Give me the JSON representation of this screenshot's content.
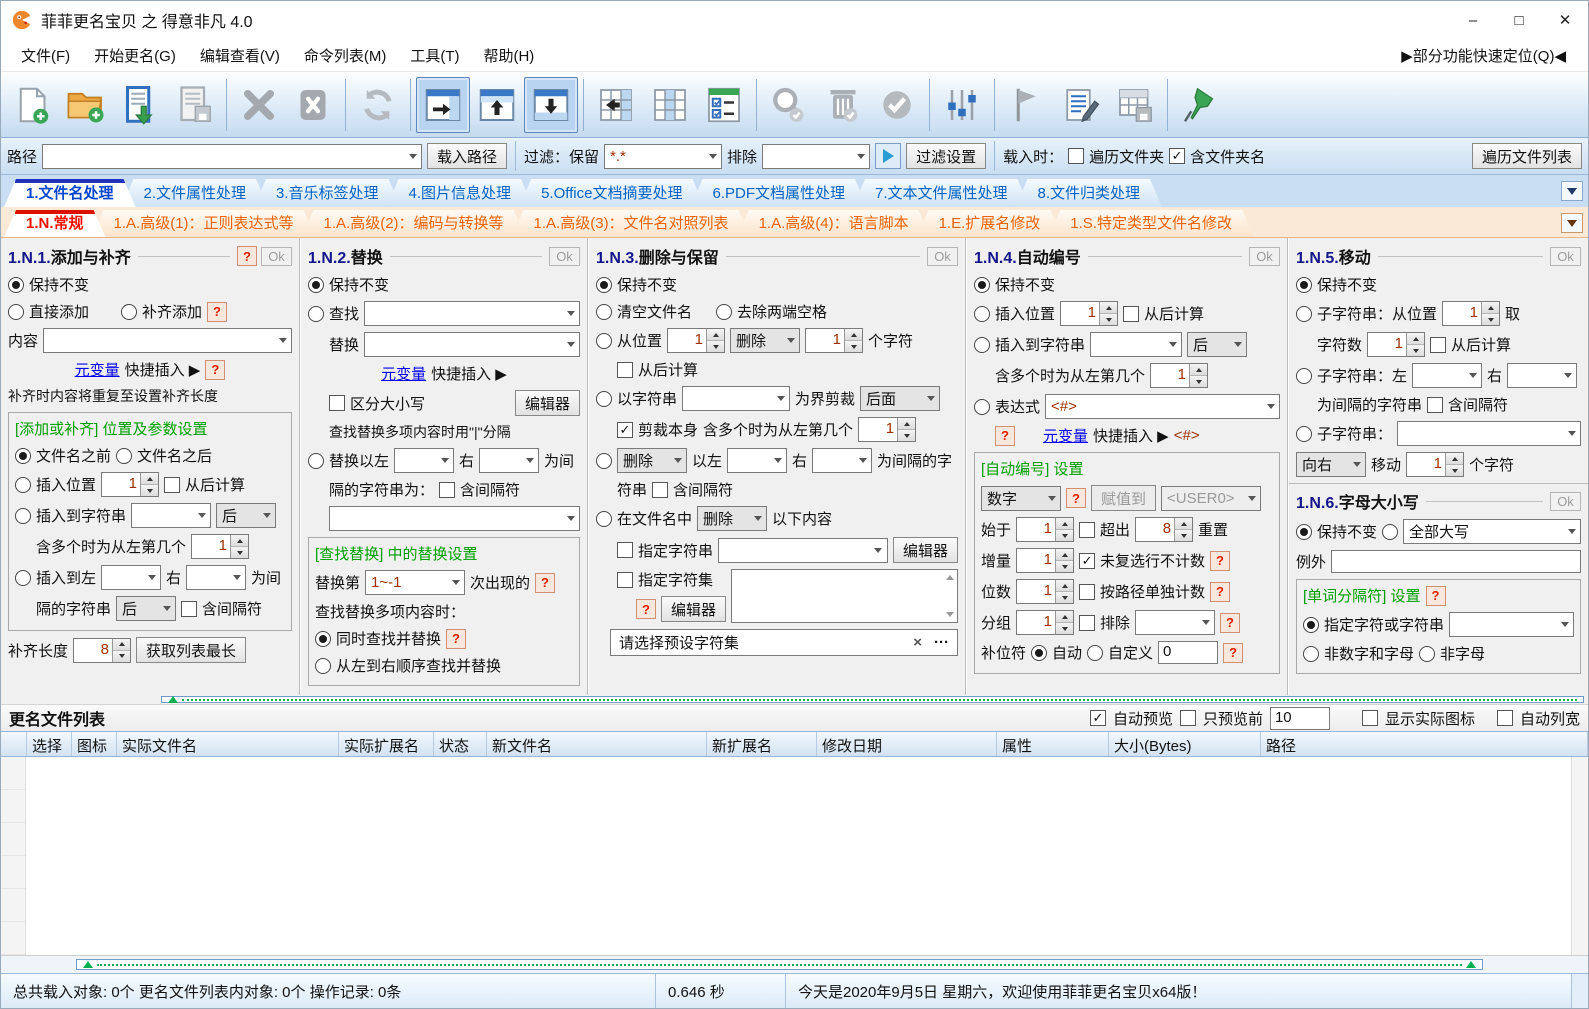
{
  "window": {
    "title": "菲菲更名宝贝 之 得意非凡 4.0",
    "minimize": "–",
    "maximize": "□",
    "close": "✕"
  },
  "menu": {
    "items": [
      "文件(F)",
      "开始更名(G)",
      "编辑查看(V)",
      "命令列表(M)",
      "工具(T)",
      "帮助(H)"
    ],
    "quick_locate": "▶部分功能快速定位(Q)◀"
  },
  "toolbar": {
    "icons": [
      "new-file-icon",
      "open-folder-add-icon",
      "load-list-icon",
      "save-list-icon",
      "delete-icon",
      "delete-box-icon",
      "refresh-icon",
      "panel-right-icon",
      "panel-top-icon",
      "panel-bottom-icon",
      "columns-move-icon",
      "columns-icon",
      "checklist-icon",
      "search-check-icon",
      "trash-check-icon",
      "apply-check-icon",
      "settings-sliders-icon",
      "flag-icon",
      "edit-log-icon",
      "export-table-icon",
      "pin-icon"
    ]
  },
  "pathbar": {
    "path_label": "路径",
    "load_path": "载入路径",
    "filter_label": "过滤：保留",
    "filter_value": "*.*",
    "exclude_label": "排除",
    "filter_settings": "过滤设置",
    "load_opts_label": "载入时：",
    "chk_traverse": "遍历文件夹",
    "chk_foldername": "含文件夹名",
    "traverse_button": "遍历文件列表"
  },
  "tabs_main": [
    "1.文件名处理",
    "2.文件属性处理",
    "3.音乐标签处理",
    "4.图片信息处理",
    "5.Office文档摘要处理",
    "6.PDF文档属性处理",
    "7.文本文件属性处理",
    "8.文件归类处理"
  ],
  "tabs_sub": [
    "1.N.常规",
    "1.A.高级(1)：正则表达式等",
    "1.A.高级(2)：编码与转换等",
    "1.A.高级(3)：文件名对照列表",
    "1.A.高级(4)：语言脚本",
    "1.E.扩展名修改",
    "1.S.特定类型文件名修改"
  ],
  "common": {
    "ok": "Ok",
    "help": "?",
    "keep": "保持不变",
    "editor": "编辑器",
    "meta_link": "元变量",
    "quick_insert": "快捷插入 ▶",
    "from_end": "从后计算",
    "incl_sep": "含间隔符",
    "right": "右",
    "after": "后",
    "multi_left": "含多个时为从左第几个"
  },
  "p1": {
    "num": "1.N.1.",
    "name": "添加与补齐",
    "radio_direct": "直接添加",
    "radio_pad": "补齐添加",
    "content_label": "内容",
    "note": "补齐时内容将重复至设置补齐长度",
    "group_title": "[添加或补齐] 位置及参数设置",
    "before": "文件名之前",
    "after_name": "文件名之后",
    "insert_pos": "插入位置",
    "pos_val": "1",
    "insert_to_str": "插入到字符串",
    "multi_val": "1",
    "insert_between": "插入到左",
    "between_suffix": "为间",
    "line_sep": "隔的字符串",
    "pad_len_label": "补齐长度",
    "pad_len": "8",
    "get_longest": "获取列表最长"
  },
  "p2": {
    "num": "1.N.2.",
    "name": "替换",
    "find": "查找",
    "replace": "替换",
    "case_sensitive": "区分大小写",
    "note": "查找替换多项内容时用\"|\"分隔",
    "rep_between": "替换以左",
    "between_suffix": "为间",
    "line2": "隔的字符串为：",
    "group_title": "[查找替换] 中的替换设置",
    "nth_label": "替换第",
    "nth_val": "1~-1",
    "nth_suffix": "次出现的",
    "multi_label": "查找替换多项内容时：",
    "simul": "同时查找并替换",
    "ordered": "从左到右顺序查找并替换"
  },
  "p3": {
    "num": "1.N.3.",
    "name": "删除与保留",
    "clear": "清空文件名",
    "trim": "去除两端空格",
    "from_pos": "从位置",
    "pos_val": "1",
    "del_combo": "删除",
    "count_val": "1",
    "chars_suffix": "个字符",
    "by_str": "以字符串",
    "cut_label": "为界剪裁",
    "cut_side": "后面",
    "cut_self": "剪裁本身",
    "multi_val": "1",
    "between_prefix": "以左",
    "between_suffix": "为间隔的字",
    "line_cont": "符串",
    "in_name": "在文件名中",
    "content_suffix": "以下内容",
    "spec_str": "指定字符串",
    "spec_set": "指定字符集",
    "preset_placeholder": "请选择预设字符集",
    "clear_x": "×",
    "more": "···"
  },
  "p4": {
    "num": "1.N.4.",
    "name": "自动编号",
    "insert_pos": "插入位置",
    "pos_val": "1",
    "insert_to_str": "插入到字符串",
    "multi_val": "1",
    "expr": "表达式",
    "expr_val": "<#>",
    "token": "<#>",
    "group_title": "[自动编号] 设置",
    "type_val": "数字",
    "assign": "赋值到",
    "assign_val": "<USER0>",
    "start": "始于",
    "start_val": "1",
    "over": "超出",
    "over_val": "8",
    "reset": "重置",
    "inc": "增量",
    "inc_val": "1",
    "uncheck": "未复选行不计数",
    "digits": "位数",
    "digits_val": "1",
    "per_path": "按路径单独计数",
    "group": "分组",
    "group_val": "1",
    "exclude": "排除",
    "pad_char": "补位符",
    "auto": "自动",
    "custom": "自定义",
    "custom_val": "0"
  },
  "p5": {
    "num": "1.N.5.",
    "name": "移动",
    "sub_pos": "子字符串：从位置",
    "pos_val": "1",
    "take": "取",
    "char_count": "字符数",
    "count_val": "1",
    "sub_lr": "子字符串：左",
    "sep_line": "为间隔的字符串",
    "sub_str": "子字符串：",
    "dir_val": "向右",
    "move": "移动",
    "move_val": "1",
    "chars": "个字符"
  },
  "p6": {
    "num": "1.N.6.",
    "name": "字母大小写",
    "case_val": "全部大写",
    "except": "例外",
    "group_title": "[单词分隔符] 设置",
    "spec": "指定字符或字符串",
    "non_alnum": "非数字和字母",
    "non_alpha": "非字母"
  },
  "filelist": {
    "section_title": "更名文件列表",
    "auto_preview": "自动预览",
    "preview_first": "只预览前",
    "preview_count": "10",
    "show_icons": "显示实际图标",
    "auto_width": "自动列宽",
    "columns": [
      "选择",
      "图标",
      "实际文件名",
      "实际扩展名",
      "状态",
      "新文件名",
      "新扩展名",
      "修改日期",
      "属性",
      "大小(Bytes)",
      "路径"
    ]
  },
  "statusbar": {
    "counts": "总共载入对象: 0个  更名文件列表内对象: 0个  操作记录: 0条",
    "time": "0.646 秒",
    "message": "今天是2020年9月5日 星期六，欢迎使用菲菲更名宝贝x64版！"
  },
  "colors": {
    "accent_blue": "#0563c1",
    "tab_orange": "#e8650a",
    "active_red": "#ee1100",
    "green": "#00a000",
    "link_blue": "#0000ee",
    "value_maroon": "#a03000",
    "pin_green": "#3aa655"
  }
}
